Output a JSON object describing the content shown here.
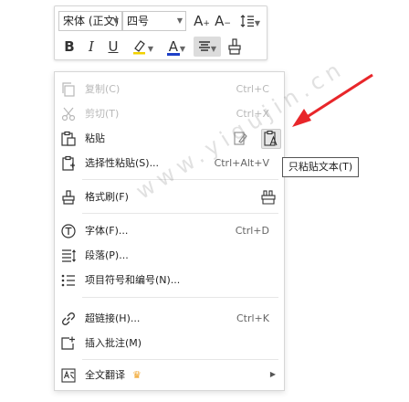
{
  "minibar": {
    "font_name": "宋体 (正文)",
    "font_size": "四号",
    "grow_font": "A",
    "shrink_font": "A",
    "bold": "B",
    "italic": "I",
    "underline": "U",
    "font_color": "A"
  },
  "menu": {
    "copy": {
      "label": "复制(C)",
      "shortcut": "Ctrl+C"
    },
    "cut": {
      "label": "剪切(T)",
      "shortcut": "Ctrl+X"
    },
    "paste": {
      "label": "粘贴"
    },
    "paste_special": {
      "label": "选择性粘贴(S)...",
      "shortcut": "Ctrl+Alt+V"
    },
    "format_painter": {
      "label": "格式刷(F)"
    },
    "font": {
      "label": "字体(F)...",
      "shortcut": "Ctrl+D"
    },
    "paragraph": {
      "label": "段落(P)..."
    },
    "bullets": {
      "label": "项目符号和编号(N)..."
    },
    "hyperlink": {
      "label": "超链接(H)...",
      "shortcut": "Ctrl+K"
    },
    "comment": {
      "label": "插入批注(M)"
    },
    "translate": {
      "label": "全文翻译"
    }
  },
  "tooltip": {
    "text": "只粘贴文本(T)"
  },
  "watermark": {
    "text": "www.yigujin.cn"
  },
  "colors": {
    "font_color_bar": "#1e40c8",
    "highlight_bar": "#f2d100",
    "arrow": "#e8262a",
    "crown": "#f0a020"
  }
}
